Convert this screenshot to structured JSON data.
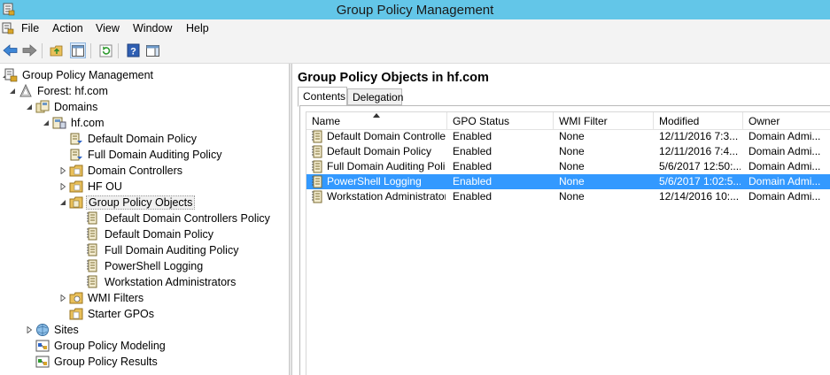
{
  "window": {
    "title": "Group Policy Management"
  },
  "menu": {
    "items": [
      "File",
      "Action",
      "View",
      "Window",
      "Help"
    ]
  },
  "toolbar": {
    "buttons": [
      "back-icon",
      "forward-icon",
      "up-folder-icon",
      "show-hide-tree-icon",
      "refresh-icon",
      "help-icon",
      "show-action-pane-icon"
    ]
  },
  "tree": {
    "nodes": [
      {
        "label": "Group Policy Management",
        "icon": "gpm-console-icon",
        "expander": "expanded-arrow"
      },
      {
        "label": "Forest: hf.com",
        "icon": "forest-icon",
        "expander": "expanded-arrow"
      },
      {
        "label": "Domains",
        "icon": "domains-icon",
        "expander": "expanded-arrow"
      },
      {
        "label": "hf.com",
        "icon": "domain-icon",
        "expander": "expanded-arrow"
      },
      {
        "label": "Default Domain Policy",
        "icon": "gpo-link-icon"
      },
      {
        "label": "Full Domain Auditing Policy",
        "icon": "gpo-link-icon"
      },
      {
        "label": "Domain Controllers",
        "icon": "ou-folder-icon",
        "expander": "collapsed-arrow"
      },
      {
        "label": "HF OU",
        "icon": "ou-folder-icon",
        "expander": "collapsed-arrow"
      },
      {
        "label": "Group Policy Objects",
        "icon": "gpo-folder-icon",
        "expander": "expanded-arrow",
        "selected": true
      },
      {
        "label": "Default Domain Controllers Policy",
        "icon": "gpo-icon"
      },
      {
        "label": "Default Domain Policy",
        "icon": "gpo-icon"
      },
      {
        "label": "Full Domain Auditing Policy",
        "icon": "gpo-icon"
      },
      {
        "label": "PowerShell Logging",
        "icon": "gpo-icon"
      },
      {
        "label": "Workstation Administrators",
        "icon": "gpo-icon"
      },
      {
        "label": "WMI Filters",
        "icon": "wmi-folder-icon",
        "expander": "collapsed-arrow"
      },
      {
        "label": "Starter GPOs",
        "icon": "starter-folder-icon"
      },
      {
        "label": "Sites",
        "icon": "sites-icon",
        "expander": "collapsed-arrow"
      },
      {
        "label": "Group Policy Modeling",
        "icon": "modeling-icon"
      },
      {
        "label": "Group Policy Results",
        "icon": "results-icon"
      }
    ]
  },
  "main": {
    "title": "Group Policy Objects in hf.com",
    "tabs": [
      {
        "label": "Contents",
        "active": true
      },
      {
        "label": "Delegation",
        "active": false
      }
    ],
    "columns": [
      "Name",
      "GPO Status",
      "WMI Filter",
      "Modified",
      "Owner"
    ],
    "sort": {
      "column": "Name",
      "direction": "ascending"
    },
    "rows": [
      {
        "name": "Default Domain Controller...",
        "status": "Enabled",
        "wmi": "None",
        "modified": "12/11/2016 7:3...",
        "owner": "Domain Admi...",
        "selected": false
      },
      {
        "name": "Default Domain Policy",
        "status": "Enabled",
        "wmi": "None",
        "modified": "12/11/2016 7:4...",
        "owner": "Domain Admi...",
        "selected": false
      },
      {
        "name": "Full Domain Auditing Policy",
        "status": "Enabled",
        "wmi": "None",
        "modified": "5/6/2017 12:50:...",
        "owner": "Domain Admi...",
        "selected": false
      },
      {
        "name": "PowerShell Logging",
        "status": "Enabled",
        "wmi": "None",
        "modified": "5/6/2017 1:02:5...",
        "owner": "Domain Admi...",
        "selected": true
      },
      {
        "name": "Workstation Administrators",
        "status": "Enabled",
        "wmi": "None",
        "modified": "12/14/2016 10:...",
        "owner": "Domain Admi...",
        "selected": false
      }
    ]
  },
  "colors": {
    "titlebar": "#63c6e8",
    "selection": "#3399ff",
    "chrome": "#f3f3f3"
  }
}
